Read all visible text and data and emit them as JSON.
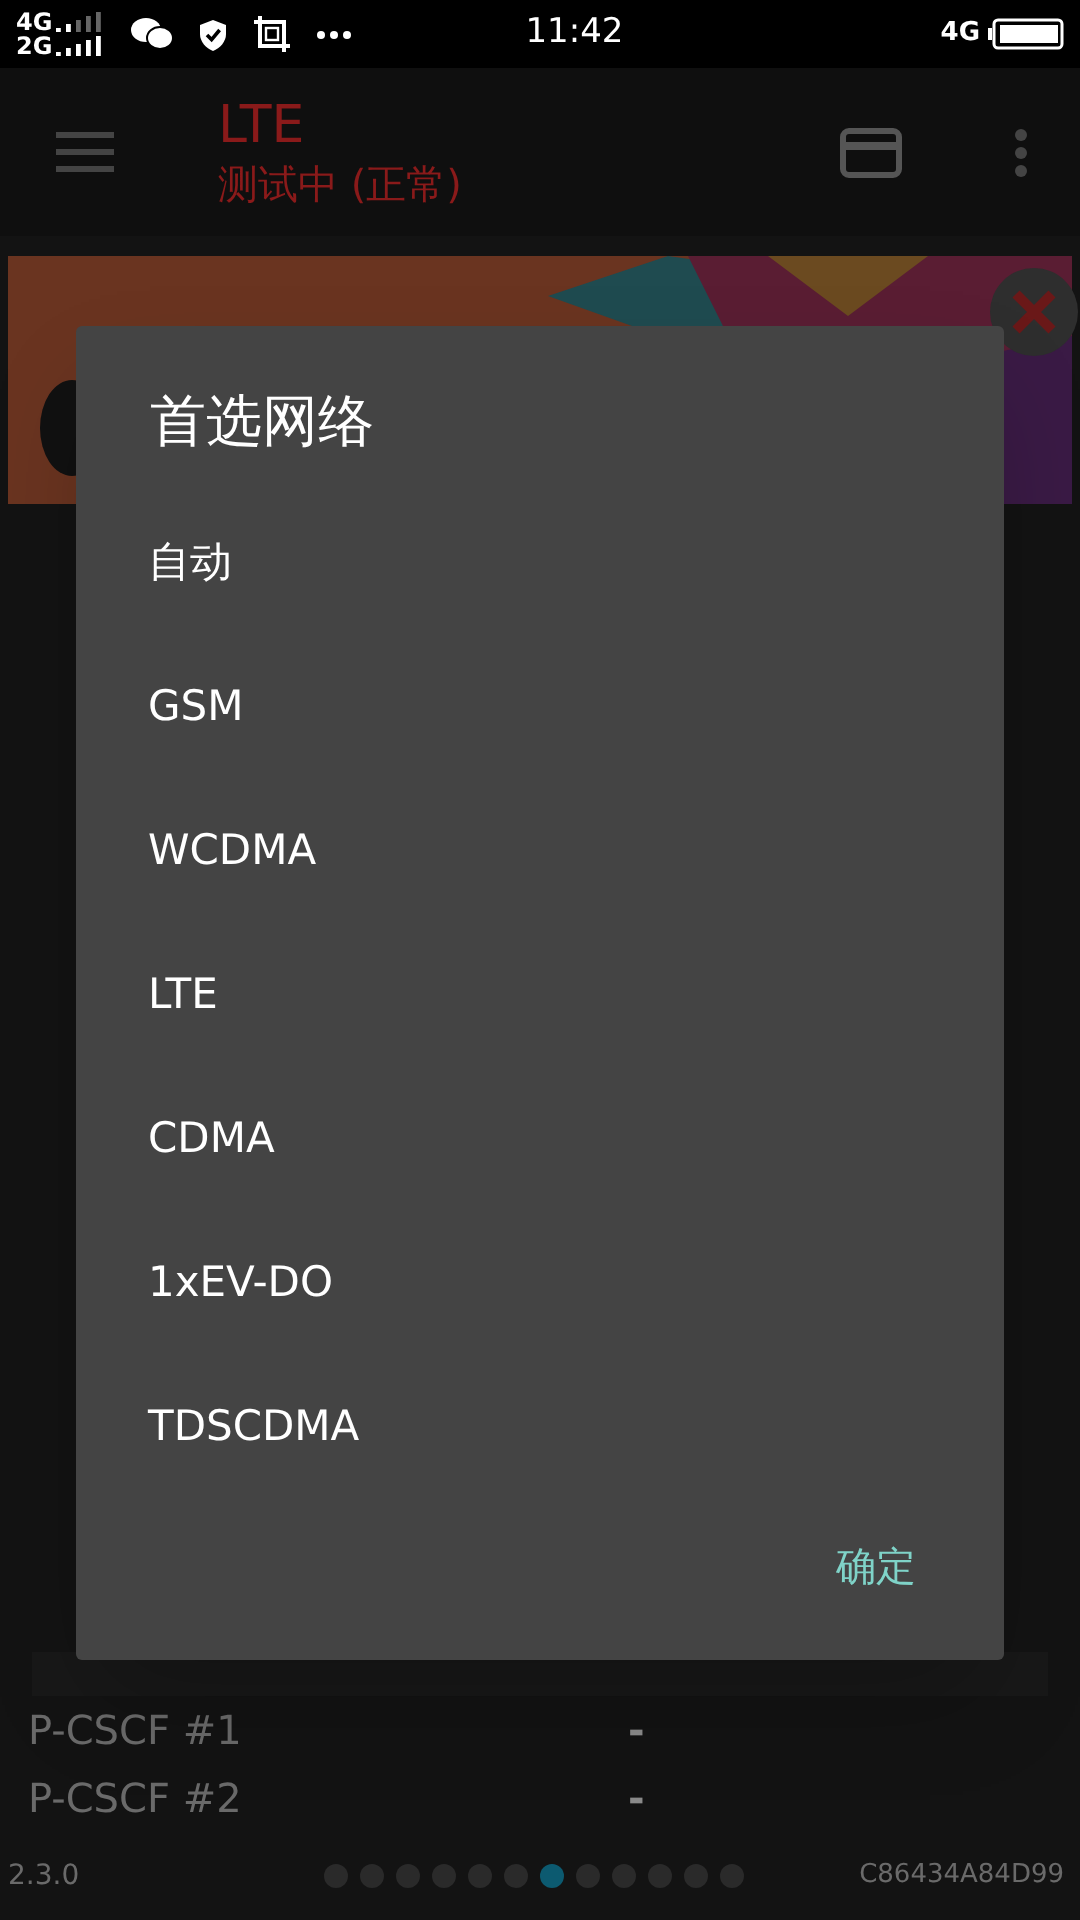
{
  "status_bar": {
    "network_top": "4G",
    "network_bottom": "2G",
    "time": "11:42",
    "network_right": "4G"
  },
  "toolbar": {
    "title": "LTE",
    "subtitle": "测试中 (正常)"
  },
  "info_rows": [
    {
      "label": "P-CSCF #1",
      "value": "-"
    },
    {
      "label": "P-CSCF #2",
      "value": "-"
    }
  ],
  "footer": {
    "version": "2.3.0",
    "device_id": "C86434A84D99"
  },
  "page_dots": [
    {
      "selected": false
    },
    {
      "selected": false
    },
    {
      "selected": false
    },
    {
      "selected": false
    },
    {
      "selected": false
    },
    {
      "selected": false
    },
    {
      "selected": true
    },
    {
      "selected": false
    },
    {
      "selected": false
    },
    {
      "selected": false
    },
    {
      "selected": false
    },
    {
      "selected": false
    }
  ],
  "dialog": {
    "title": "首选网络",
    "options": [
      "自动",
      "GSM",
      "WCDMA",
      "LTE",
      "CDMA",
      "1xEV-DO",
      "TDSCDMA"
    ],
    "confirm": "确定"
  }
}
